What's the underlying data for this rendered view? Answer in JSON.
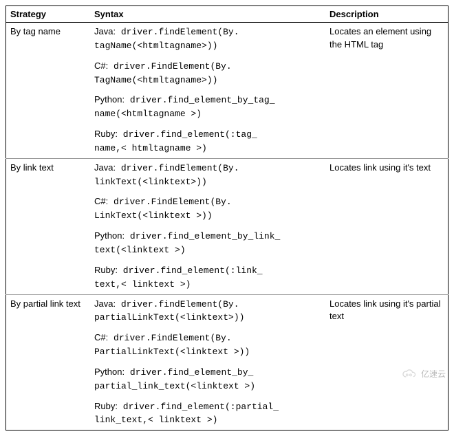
{
  "headers": {
    "strategy": "Strategy",
    "syntax": "Syntax",
    "description": "Description"
  },
  "rows": [
    {
      "strategy": "By tag name",
      "description": "Locates an element using the HTML tag",
      "variants": [
        {
          "lang": "Java:",
          "code": "driver.findElement(By.\ntagName(<htmltagname>))"
        },
        {
          "lang": "C#:",
          "code": "driver.FindElement(By.\nTagName(<htmltagname>))"
        },
        {
          "lang": "Python:",
          "code": "driver.find_element_by_tag_\nname(<htmltagname >)"
        },
        {
          "lang": "Ruby:",
          "code": "driver.find_element(:tag_\nname,< htmltagname >)"
        }
      ]
    },
    {
      "strategy": "By link text",
      "description": "Locates link using it's text",
      "variants": [
        {
          "lang": "Java:",
          "code": "driver.findElement(By.\nlinkText(<linktext>))"
        },
        {
          "lang": "C#:",
          "code": "driver.FindElement(By.\nLinkText(<linktext >))"
        },
        {
          "lang": "Python:",
          "code": "driver.find_element_by_link_\ntext(<linktext >)"
        },
        {
          "lang": "Ruby:",
          "code": "driver.find_element(:link_\ntext,< linktext >)"
        }
      ]
    },
    {
      "strategy": "By partial link text",
      "description": "Locates link using it's partial text",
      "variants": [
        {
          "lang": "Java:",
          "code": "driver.findElement(By.\npartialLinkText(<linktext>))"
        },
        {
          "lang": "C#:",
          "code": "driver.FindElement(By.\nPartialLinkText(<linktext >))"
        },
        {
          "lang": "Python:",
          "code": "driver.find_element_by_\npartial_link_text(<linktext >)"
        },
        {
          "lang": "Ruby:",
          "code": "driver.find_element(:partial_\nlink_text,< linktext >)"
        }
      ]
    }
  ],
  "watermark": "亿速云"
}
